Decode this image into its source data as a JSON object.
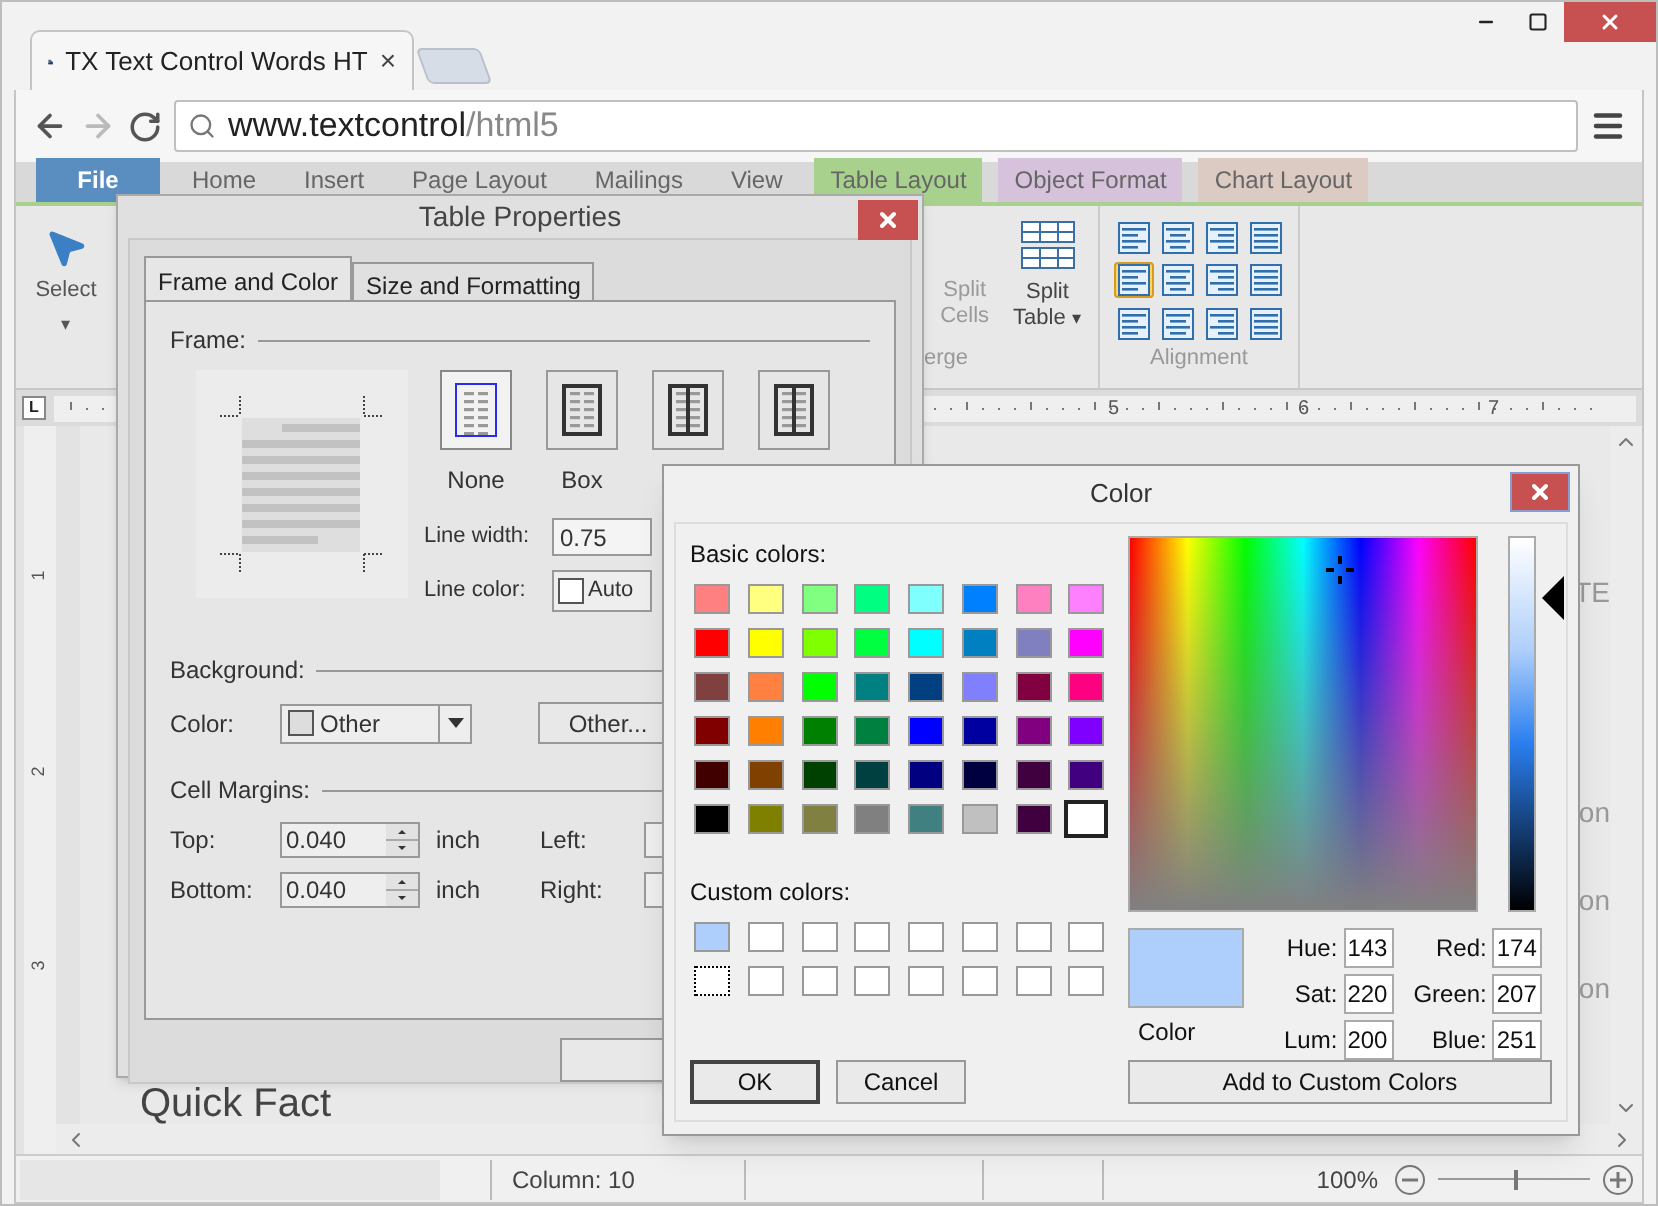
{
  "browser": {
    "tab_title": "TX Text Control Words HT",
    "tab_close": "×",
    "url_host": "www.textcontrol",
    "url_path": "/html5"
  },
  "ribbon_tabs": [
    {
      "label": "File",
      "selected": true,
      "color": "#5b8ec0"
    },
    {
      "label": "Home",
      "selected": false
    },
    {
      "label": "Insert",
      "selected": false
    },
    {
      "label": "Page Layout",
      "selected": false
    },
    {
      "label": "Mailings",
      "selected": false
    },
    {
      "label": "View",
      "selected": false
    },
    {
      "label": "Table Layout",
      "selected": false,
      "color": "#a9d18e"
    },
    {
      "label": "Object Format",
      "selected": false,
      "color": "#d6c2da"
    },
    {
      "label": "Chart Layout",
      "selected": false,
      "color": "#dccbc2"
    }
  ],
  "ribbon": {
    "select": {
      "label": "Select",
      "caret": "▾"
    },
    "split_cells": {
      "lines": [
        "Split",
        "Cells"
      ],
      "disabled": true
    },
    "split_table": {
      "lines": [
        "Split",
        "Table"
      ],
      "caret": "▾"
    },
    "merge_label": "erge",
    "alignment": {
      "label": "Alignment",
      "buttons": [
        {
          "selected": false
        },
        {
          "selected": false
        },
        {
          "selected": false
        },
        {
          "selected": false
        },
        {
          "selected": true
        },
        {
          "selected": false
        },
        {
          "selected": false
        },
        {
          "selected": false
        },
        {
          "selected": false
        },
        {
          "selected": false
        },
        {
          "selected": false
        },
        {
          "selected": false
        }
      ]
    }
  },
  "ruler": {
    "corner": "L",
    "numbers": [
      "5",
      "6",
      "7"
    ]
  },
  "vertical_ruler": {
    "numbers": [
      "1",
      "2",
      "3"
    ]
  },
  "document": {
    "fragments": [
      "TE",
      "on",
      "on",
      "on"
    ],
    "heading": "Quick Fact"
  },
  "status_bar": {
    "column": "Column: 10",
    "zoom": "100%",
    "zoom_slider": {
      "level": 0.5
    }
  },
  "table_properties": {
    "title": "Table Properties",
    "tabs": [
      {
        "label": "Frame and Color",
        "selected": true
      },
      {
        "label": "Size and Formatting",
        "selected": false
      }
    ],
    "frame_label": "Frame:",
    "frame_buttons": [
      {
        "kind": "none",
        "label": "None",
        "selected": true
      },
      {
        "kind": "box",
        "label": "Box",
        "selected": false
      },
      {
        "kind": "columns",
        "selected": false
      },
      {
        "kind": "columns",
        "selected": false
      }
    ],
    "line_width": {
      "label": "Line width:",
      "value": "0.75"
    },
    "line_color": {
      "label": "Line color:",
      "value": "Auto"
    },
    "background": {
      "label": "Background:",
      "color_label": "Color:",
      "value": "Other",
      "other_button": "Other..."
    },
    "cell_margins": {
      "label": "Cell Margins:",
      "fields": [
        {
          "label": "Top:",
          "value": "0.040",
          "unit": "inch",
          "side": "Left:"
        },
        {
          "label": "Bottom:",
          "value": "0.040",
          "unit": "inch",
          "side": "Right:"
        }
      ]
    }
  },
  "color_dialog": {
    "title": "Color",
    "basic_label": "Basic colors:",
    "basic_colors": [
      {
        "color": "#ff8080",
        "selected": false
      },
      {
        "color": "#ffff80",
        "selected": false
      },
      {
        "color": "#80ff80",
        "selected": false
      },
      {
        "color": "#00ff80",
        "selected": false
      },
      {
        "color": "#80ffff",
        "selected": false
      },
      {
        "color": "#0080ff",
        "selected": false
      },
      {
        "color": "#ff80c0",
        "selected": false
      },
      {
        "color": "#ff80ff",
        "selected": false
      },
      {
        "color": "#ff0000",
        "selected": false
      },
      {
        "color": "#ffff00",
        "selected": false
      },
      {
        "color": "#80ff00",
        "selected": false
      },
      {
        "color": "#00ff40",
        "selected": false
      },
      {
        "color": "#00ffff",
        "selected": false
      },
      {
        "color": "#0080c0",
        "selected": false
      },
      {
        "color": "#8080c0",
        "selected": false
      },
      {
        "color": "#ff00ff",
        "selected": false
      },
      {
        "color": "#804040",
        "selected": false
      },
      {
        "color": "#ff8040",
        "selected": false
      },
      {
        "color": "#00ff00",
        "selected": false
      },
      {
        "color": "#008080",
        "selected": false
      },
      {
        "color": "#004080",
        "selected": false
      },
      {
        "color": "#8080ff",
        "selected": false
      },
      {
        "color": "#800040",
        "selected": false
      },
      {
        "color": "#ff0080",
        "selected": false
      },
      {
        "color": "#800000",
        "selected": false
      },
      {
        "color": "#ff8000",
        "selected": false
      },
      {
        "color": "#008000",
        "selected": false
      },
      {
        "color": "#008040",
        "selected": false
      },
      {
        "color": "#0000ff",
        "selected": false
      },
      {
        "color": "#0000a0",
        "selected": false
      },
      {
        "color": "#800080",
        "selected": false
      },
      {
        "color": "#8000ff",
        "selected": false
      },
      {
        "color": "#400000",
        "selected": false
      },
      {
        "color": "#804000",
        "selected": false
      },
      {
        "color": "#004000",
        "selected": false
      },
      {
        "color": "#004040",
        "selected": false
      },
      {
        "color": "#000080",
        "selected": false
      },
      {
        "color": "#000040",
        "selected": false
      },
      {
        "color": "#400040",
        "selected": false
      },
      {
        "color": "#400080",
        "selected": false
      },
      {
        "color": "#000000",
        "selected": false
      },
      {
        "color": "#808000",
        "selected": false
      },
      {
        "color": "#808040",
        "selected": false
      },
      {
        "color": "#808080",
        "selected": false
      },
      {
        "color": "#408080",
        "selected": false
      },
      {
        "color": "#c0c0c0",
        "selected": false
      },
      {
        "color": "#400040",
        "selected": false
      },
      {
        "color": "#ffffff",
        "selected": true
      }
    ],
    "custom_label": "Custom colors:",
    "custom_colors": [
      {
        "color": "#aecffb",
        "focused": false
      },
      {
        "color": "#ffffff",
        "focused": false
      },
      {
        "color": "#ffffff",
        "focused": false
      },
      {
        "color": "#ffffff",
        "focused": false
      },
      {
        "color": "#ffffff",
        "focused": false
      },
      {
        "color": "#ffffff",
        "focused": false
      },
      {
        "color": "#ffffff",
        "focused": false
      },
      {
        "color": "#ffffff",
        "focused": false
      },
      {
        "color": "#ffffff",
        "focused": true
      },
      {
        "color": "#ffffff",
        "focused": false
      },
      {
        "color": "#ffffff",
        "focused": false
      },
      {
        "color": "#ffffff",
        "focused": false
      },
      {
        "color": "#ffffff",
        "focused": false
      },
      {
        "color": "#ffffff",
        "focused": false
      },
      {
        "color": "#ffffff",
        "focused": false
      },
      {
        "color": "#ffffff",
        "focused": false
      }
    ],
    "luminance_slider": {
      "level": 0.84
    },
    "preview": {
      "color": "#aecffb",
      "label": "Color"
    },
    "fields": [
      {
        "label": "Hue:",
        "value": "143"
      },
      {
        "label": "Red:",
        "value": "174"
      },
      {
        "label": "Sat:",
        "value": "220"
      },
      {
        "label": "Green:",
        "value": "207"
      },
      {
        "label": "Lum:",
        "value": "200"
      },
      {
        "label": "Blue:",
        "value": "251"
      }
    ],
    "ok": "OK",
    "cancel": "Cancel",
    "add": "Add to Custom Colors"
  }
}
